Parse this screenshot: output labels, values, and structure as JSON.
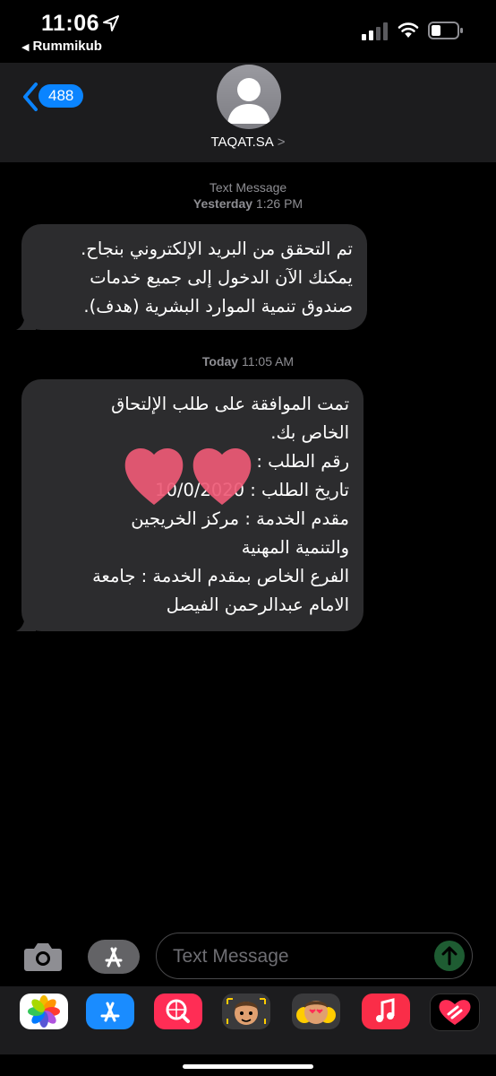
{
  "status_bar": {
    "time": "11:06",
    "back_app": "Rummikub"
  },
  "header": {
    "back_count": "488",
    "contact_name": "TAQAT.SA",
    "chevron": ">"
  },
  "messages": [
    {
      "meta_type": "Text Message",
      "meta_time_day": "Yesterday",
      "meta_time": "1:26 PM",
      "lines": [
        "تم التحقق من البريد الإلكتروني بنجاح.",
        "يمكنك الآن الدخول إلى جميع خدمات",
        "صندوق تنمية الموارد البشرية (هدف)."
      ]
    },
    {
      "meta_time_day": "Today",
      "meta_time": "11:05 AM",
      "lines": [
        "تمت الموافقة على طلب الإلتحاق",
        "الخاص بك.",
        "رقم الطلب :",
        "تاريخ الطلب : 10/0/2020",
        "مقدم الخدمة : مركز الخريجين",
        "والتنمية المهنية",
        "الفرع الخاص بمقدم الخدمة : جامعة",
        "الامام عبدالرحمن الفيصل"
      ]
    }
  ],
  "composer": {
    "placeholder": "Text Message"
  },
  "app_drawer": {
    "icons": [
      "photos-icon",
      "app-store-icon",
      "web-search-icon",
      "memoji-icon",
      "memoji-stickers-icon",
      "music-icon",
      "digital-touch-icon"
    ]
  },
  "colors": {
    "accent": "#0a84ff",
    "bubble": "#2c2c2e",
    "header_bg": "#1c1c1e"
  }
}
